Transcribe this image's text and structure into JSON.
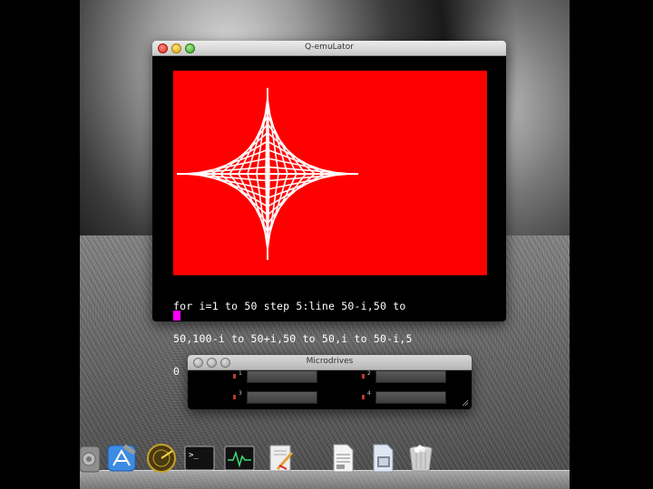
{
  "qemu_window": {
    "title": "Q-emuLator",
    "console_lines": [
      "for i=1 to 50 step 5:line 50-i,50 to",
      "50,100-i to 50+i,50 to 50,i to 50-i,5",
      "0"
    ],
    "screen_color": "#ff0000"
  },
  "microdrives_window": {
    "title": "Microdrives",
    "drives": [
      "1",
      "2",
      "3",
      "4"
    ]
  },
  "dock": {
    "icons": [
      "system-preferences-icon",
      "xcode-icon",
      "radar-icon",
      "terminal-icon",
      "activity-monitor-icon",
      "script-editor-icon",
      "text-document-icon",
      "preview-icon",
      "trash-icon"
    ]
  },
  "colors": {
    "screen_background": "#ff0000",
    "cursor": "#ff00ff"
  }
}
